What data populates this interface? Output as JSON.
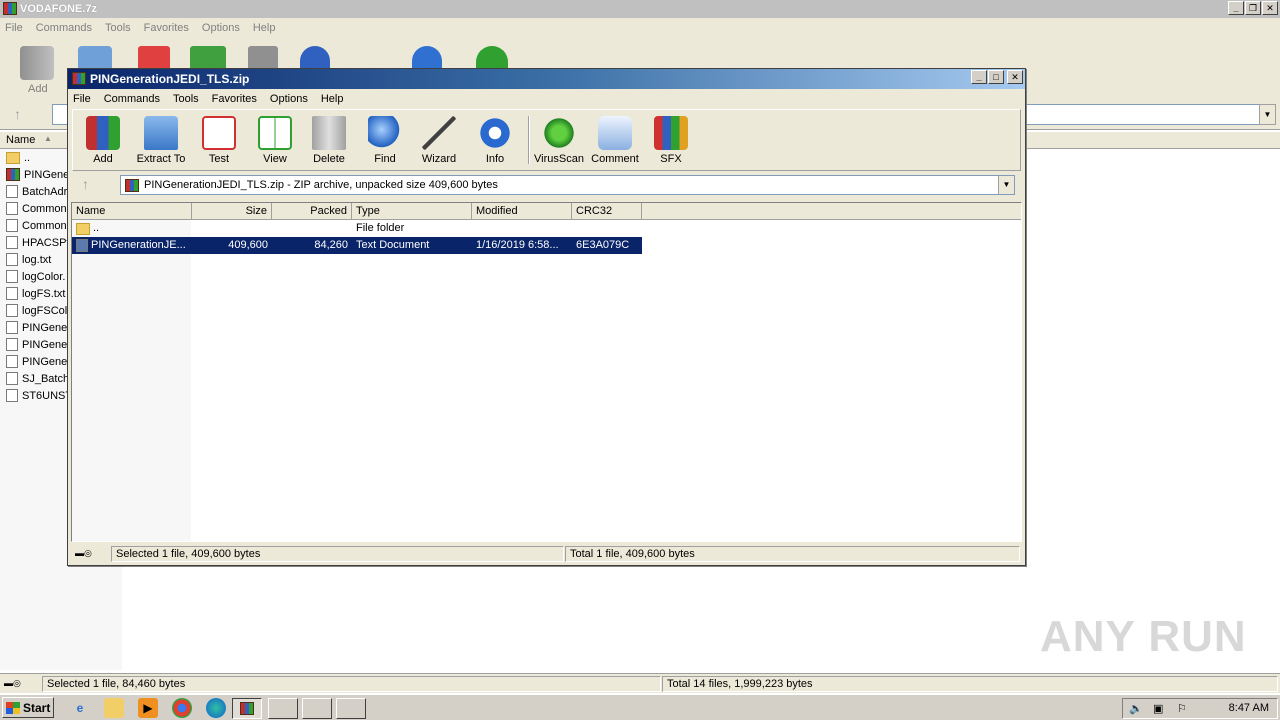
{
  "background_window": {
    "title": "VODAFONE.7z",
    "menu": [
      "File",
      "Commands",
      "Tools",
      "Favorites",
      "Options",
      "Help"
    ],
    "toolbar_first_label": "Add",
    "column_name": "Name",
    "files": [
      "..",
      "PINGene",
      "BatchAdr",
      "Common",
      "Common",
      "HPACSPt",
      "log.txt",
      "logColor.",
      "logFS.txt",
      "logFSCol",
      "PINGene",
      "PINGene",
      "PINGene",
      "SJ_Batch",
      "ST6UNST"
    ],
    "status_left": "Selected 1 file, 84,460 bytes",
    "status_right": "Total 14 files, 1,999,223 bytes"
  },
  "dialog": {
    "title": "PINGenerationJEDI_TLS.zip",
    "menu": [
      "File",
      "Commands",
      "Tools",
      "Favorites",
      "Options",
      "Help"
    ],
    "toolbar": [
      {
        "label": "Add",
        "icon": "add-archive-icon"
      },
      {
        "label": "Extract To",
        "icon": "extract-folder-icon"
      },
      {
        "label": "Test",
        "icon": "test-clipboard-icon"
      },
      {
        "label": "View",
        "icon": "view-book-icon"
      },
      {
        "label": "Delete",
        "icon": "trash-icon"
      },
      {
        "label": "Find",
        "icon": "magnifier-icon"
      },
      {
        "label": "Wizard",
        "icon": "wand-icon"
      },
      {
        "label": "Info",
        "icon": "info-icon"
      },
      {
        "label": "VirusScan",
        "icon": "virus-icon"
      },
      {
        "label": "Comment",
        "icon": "comment-icon"
      },
      {
        "label": "SFX",
        "icon": "sfx-books-icon"
      }
    ],
    "address": "PINGenerationJEDI_TLS.zip - ZIP archive, unpacked size 409,600 bytes",
    "columns": [
      "Name",
      "Size",
      "Packed",
      "Type",
      "Modified",
      "CRC32"
    ],
    "rows": [
      {
        "name": "..",
        "size": "",
        "packed": "",
        "type": "File folder",
        "modified": "",
        "crc": ""
      },
      {
        "name": "PINGenerationJE...",
        "size": "409,600",
        "packed": "84,260",
        "type": "Text Document",
        "modified": "1/16/2019 6:58...",
        "crc": "6E3A079C"
      }
    ],
    "status_left": "Selected 1 file, 409,600 bytes",
    "status_right": "Total 1 file, 409,600 bytes"
  },
  "taskbar": {
    "start": "Start",
    "clock": "8:47 AM"
  },
  "watermark": "ANY RUN",
  "colors": {
    "selection": "#0a246a",
    "title_active": "#0a246a",
    "chrome": "#ece9d8"
  }
}
